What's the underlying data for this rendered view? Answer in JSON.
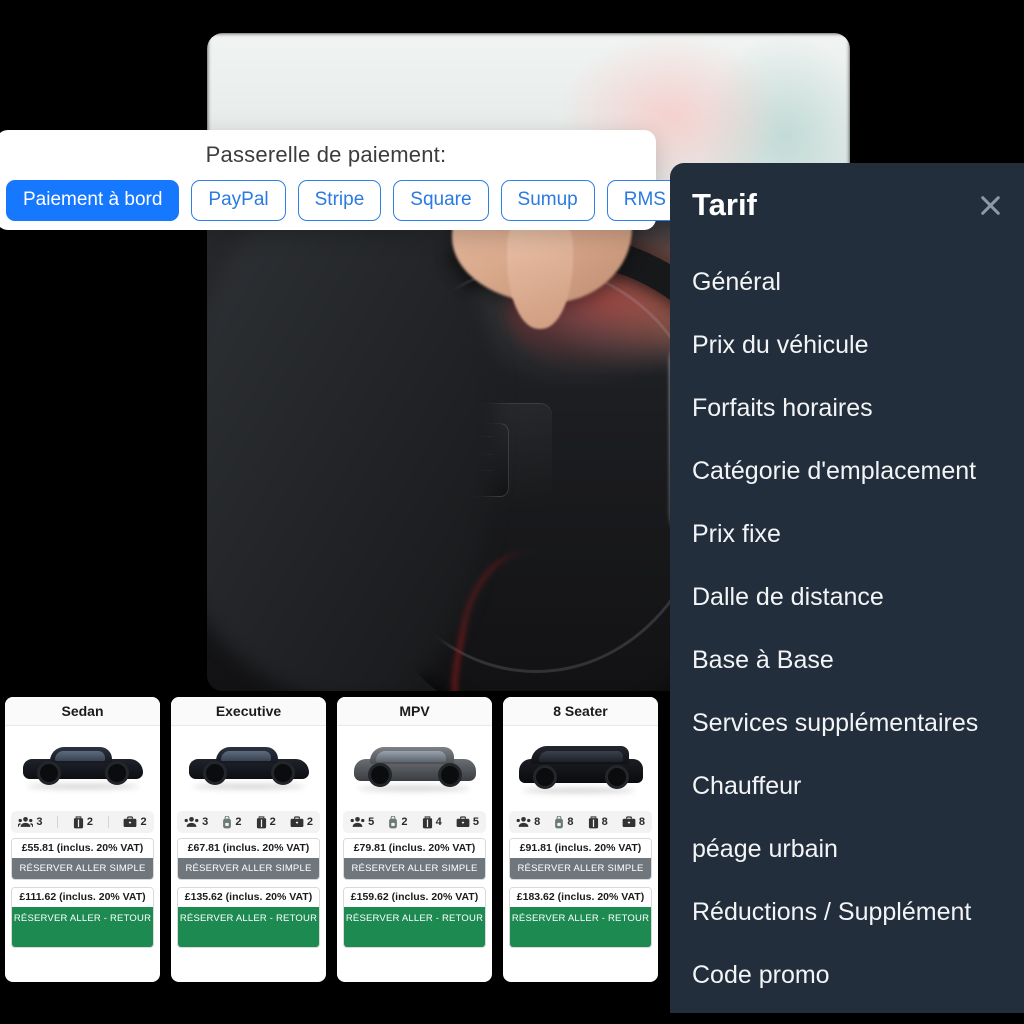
{
  "payment": {
    "title": "Passerelle de paiement:",
    "options": [
      {
        "label": "Paiement à bord",
        "active": true
      },
      {
        "label": "PayPal",
        "active": false
      },
      {
        "label": "Stripe",
        "active": false
      },
      {
        "label": "Square",
        "active": false
      },
      {
        "label": "Sumup",
        "active": false
      },
      {
        "label": "RMS",
        "active": false
      }
    ],
    "accent_color": "#1677ff",
    "outline_color": "#2a7ae2"
  },
  "tarif_panel": {
    "title": "Tarif",
    "close_icon": "close-x-icon",
    "background_color": "#232e3c",
    "items": [
      {
        "label": "Général"
      },
      {
        "label": "Prix du véhicule"
      },
      {
        "label": "Forfaits horaires"
      },
      {
        "label": "Catégorie d'emplacement"
      },
      {
        "label": "Prix fixe"
      },
      {
        "label": "Dalle de distance"
      },
      {
        "label": "Base à Base"
      },
      {
        "label": "Services supplémentaires"
      },
      {
        "label": "Chauffeur"
      },
      {
        "label": "péage urbain"
      },
      {
        "label": "Réductions / Supplément"
      },
      {
        "label": "Code promo"
      }
    ]
  },
  "hero": {
    "alt": "car-interior-steering-wheel-photo"
  },
  "fleet": {
    "oneway_label": "RÉSERVER ALLER SIMPLE",
    "return_label": "RÉSERVER ALLER - RETOUR",
    "oneway_color": "#6f777d",
    "return_color": "#1d8a52",
    "cards": [
      {
        "name": "Sedan",
        "car_icon": "sedan-car-icon",
        "capacity": [
          {
            "icon": "passengers-icon",
            "value": "3"
          },
          {
            "icon": "suitcase-icon",
            "value": "2"
          },
          {
            "icon": "briefcase-icon",
            "value": "2"
          }
        ],
        "oneway_price": "£55.81 (inclus. 20% VAT)",
        "return_price": "£111.62 (inclus. 20% VAT)"
      },
      {
        "name": "Executive",
        "car_icon": "executive-car-icon",
        "capacity": [
          {
            "icon": "passengers-icon",
            "value": "3"
          },
          {
            "icon": "backpack-icon",
            "value": "2"
          },
          {
            "icon": "suitcase-icon",
            "value": "2"
          },
          {
            "icon": "briefcase-icon",
            "value": "2"
          }
        ],
        "oneway_price": "£67.81 (inclus. 20% VAT)",
        "return_price": "£135.62 (inclus. 20% VAT)"
      },
      {
        "name": "MPV",
        "car_icon": "mpv-car-icon",
        "capacity": [
          {
            "icon": "passengers-icon",
            "value": "5"
          },
          {
            "icon": "backpack-icon",
            "value": "2"
          },
          {
            "icon": "suitcase-icon",
            "value": "4"
          },
          {
            "icon": "briefcase-icon",
            "value": "5"
          }
        ],
        "oneway_price": "£79.81 (inclus. 20% VAT)",
        "return_price": "£159.62 (inclus. 20% VAT)"
      },
      {
        "name": "8 Seater",
        "car_icon": "van-car-icon",
        "capacity": [
          {
            "icon": "passengers-icon",
            "value": "8"
          },
          {
            "icon": "backpack-icon",
            "value": "8"
          },
          {
            "icon": "suitcase-icon",
            "value": "8"
          },
          {
            "icon": "briefcase-icon",
            "value": "8"
          }
        ],
        "oneway_price": "£91.81 (inclus. 20% VAT)",
        "return_price": "£183.62 (inclus. 20% VAT)"
      }
    ]
  }
}
